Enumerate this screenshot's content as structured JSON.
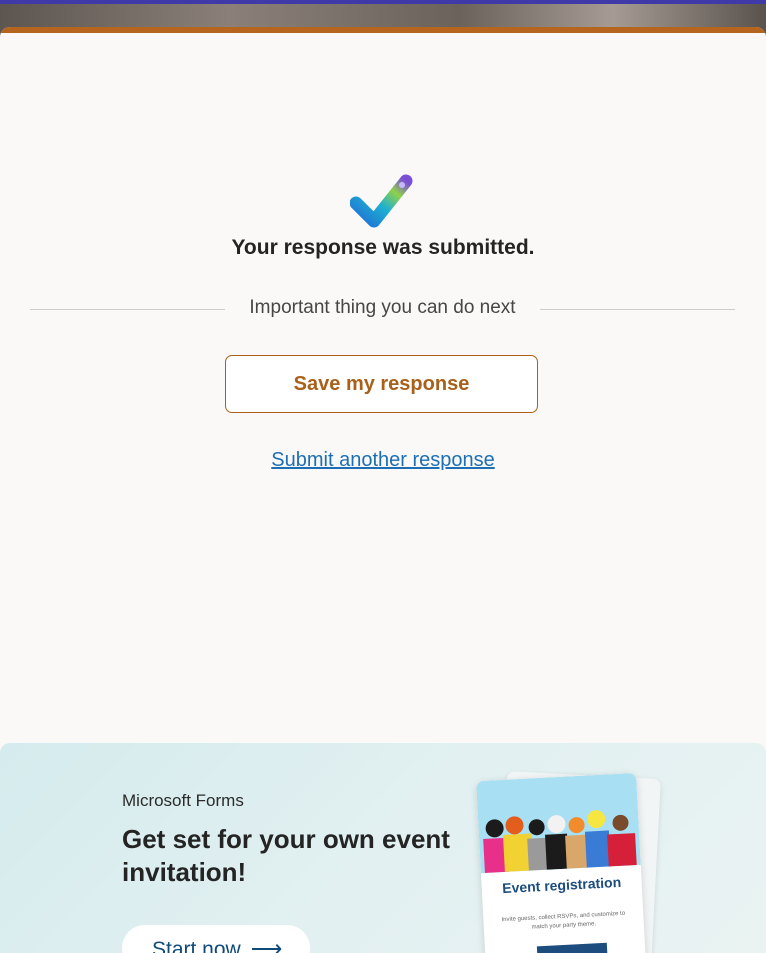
{
  "confirmation": {
    "title": "Your response was submitted.",
    "divider_text": "Important thing you can do next",
    "save_label": "Save my response",
    "another_label": "Submit another response"
  },
  "promo": {
    "brand": "Microsoft Forms",
    "headline": "Get set for your own event invitation!",
    "start_label": "Start now",
    "card_title": "Event registration",
    "card_subtitle": "Invite guests, collect RSVPs, and customize to match your party theme."
  },
  "colors": {
    "accent": "#b5651d",
    "link": "#1c6fb5",
    "top_strip": "#3f3aa8"
  },
  "icons": {
    "success": "checkmark-icon",
    "start": "arrow-right-icon"
  }
}
